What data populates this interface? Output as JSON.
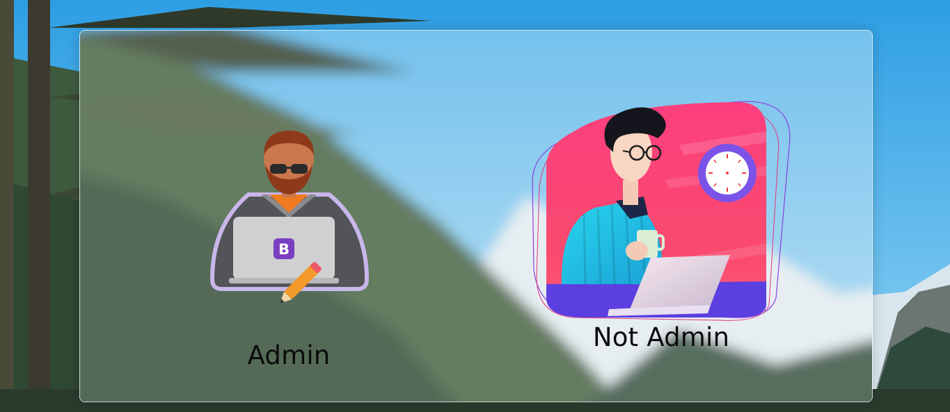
{
  "choices": {
    "admin": {
      "label": "Admin",
      "badge": "B"
    },
    "not_admin": {
      "label": "Not Admin"
    }
  },
  "colors": {
    "sky": "#39a7e6",
    "card_pink": "#fb3f7e",
    "card_purple": "#5b3fe0",
    "badge_purple": "#7b3fc1",
    "laptop_gray": "#cfd0d2"
  },
  "icons": {
    "admin": "developer-with-laptop-icon",
    "not_admin": "man-with-coffee-and-laptop-icon"
  }
}
